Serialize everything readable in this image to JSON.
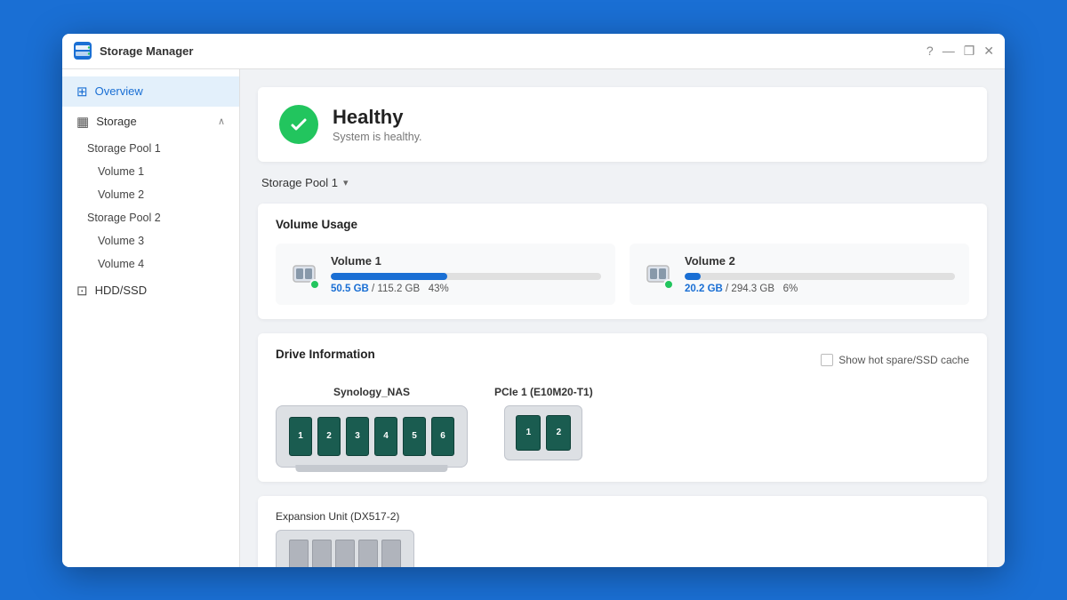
{
  "titlebar": {
    "title": "Storage Manager",
    "controls": [
      "?",
      "—",
      "❐",
      "✕"
    ]
  },
  "sidebar": {
    "overview_label": "Overview",
    "storage_label": "Storage",
    "pool1_label": "Storage Pool 1",
    "volume1_label": "Volume 1",
    "volume2_label": "Volume 2",
    "pool2_label": "Storage Pool 2",
    "volume3_label": "Volume 3",
    "volume4_label": "Volume 4",
    "hdd_ssd_label": "HDD/SSD"
  },
  "health": {
    "status": "Healthy",
    "description": "System is healthy."
  },
  "pool_selector": {
    "label": "Storage Pool 1"
  },
  "volume_usage": {
    "title": "Volume Usage",
    "volumes": [
      {
        "name": "Volume 1",
        "used_gb": "50.5 GB",
        "total_gb": "115.2 GB",
        "percent": 43,
        "percent_label": "43%"
      },
      {
        "name": "Volume 2",
        "used_gb": "20.2 GB",
        "total_gb": "294.3 GB",
        "percent": 6,
        "percent_label": "6%"
      }
    ]
  },
  "drive_information": {
    "title": "Drive Information",
    "hot_spare_label": "Show hot spare/SSD cache",
    "units": [
      {
        "label": "Synology_NAS",
        "slots": [
          "1",
          "2",
          "3",
          "4",
          "5",
          "6"
        ],
        "type": "nas"
      },
      {
        "label": "PCIe 1 (E10M20-T1)",
        "slots": [
          "1",
          "2"
        ],
        "type": "pcie"
      }
    ]
  },
  "expansion": {
    "label": "Expansion Unit (DX517-2)",
    "slot_count": 5
  },
  "colors": {
    "accent": "#1a6fd4",
    "healthy": "#22c55e",
    "drive_bg": "#1a5c50"
  }
}
